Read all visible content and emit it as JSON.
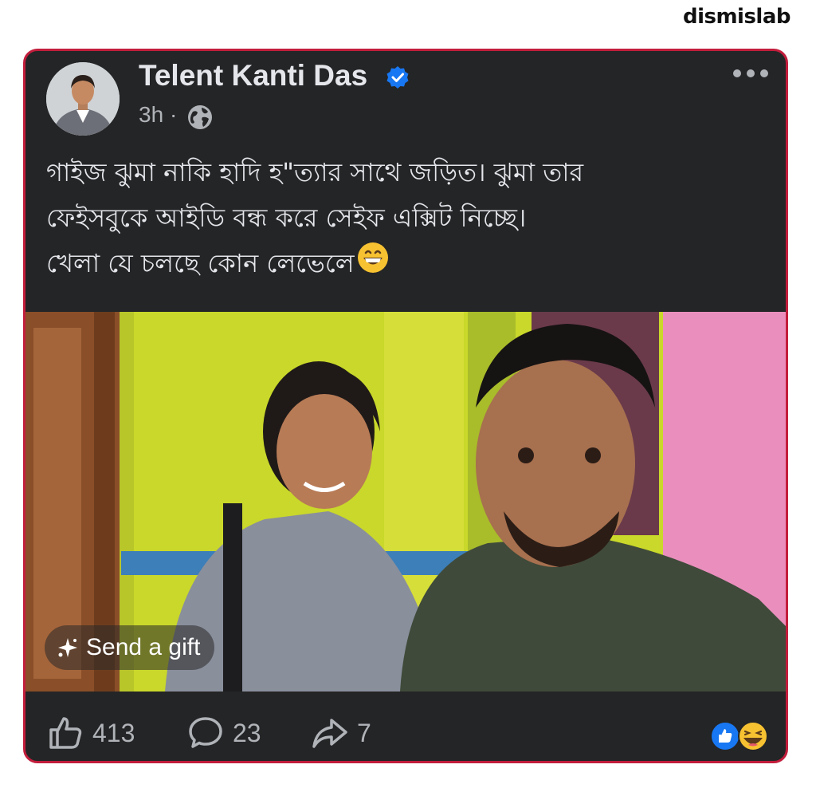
{
  "watermark": "dismislab",
  "post": {
    "author": "Telent Kanti Das",
    "verified": true,
    "time": "3h",
    "separator": "·",
    "audience_icon": "globe-icon",
    "menu_icon": "more-options-icon",
    "text_lines": [
      "গাইজ ঝুমা নাকি হাদি হ\"ত্যার সাথে জড়িত। ঝুমা তার",
      "ফেইসবুকে আইডি বন্ধ করে সেইফ এক্সিট নিচ্ছে।",
      "খেলা যে চলছে কোন লেভেলে"
    ],
    "emoji": "grinning-face-emoji",
    "gift_label": "Send a gift"
  },
  "stats": {
    "likes": "413",
    "comments": "23",
    "shares": "7",
    "reaction_icons": [
      "like-reaction-icon",
      "haha-reaction-icon"
    ]
  },
  "colors": {
    "card_bg": "#242526",
    "border": "#c21d3c",
    "text_primary": "#e4e6eb",
    "text_secondary": "#b0b3b8",
    "facebook_blue": "#1877f2"
  }
}
